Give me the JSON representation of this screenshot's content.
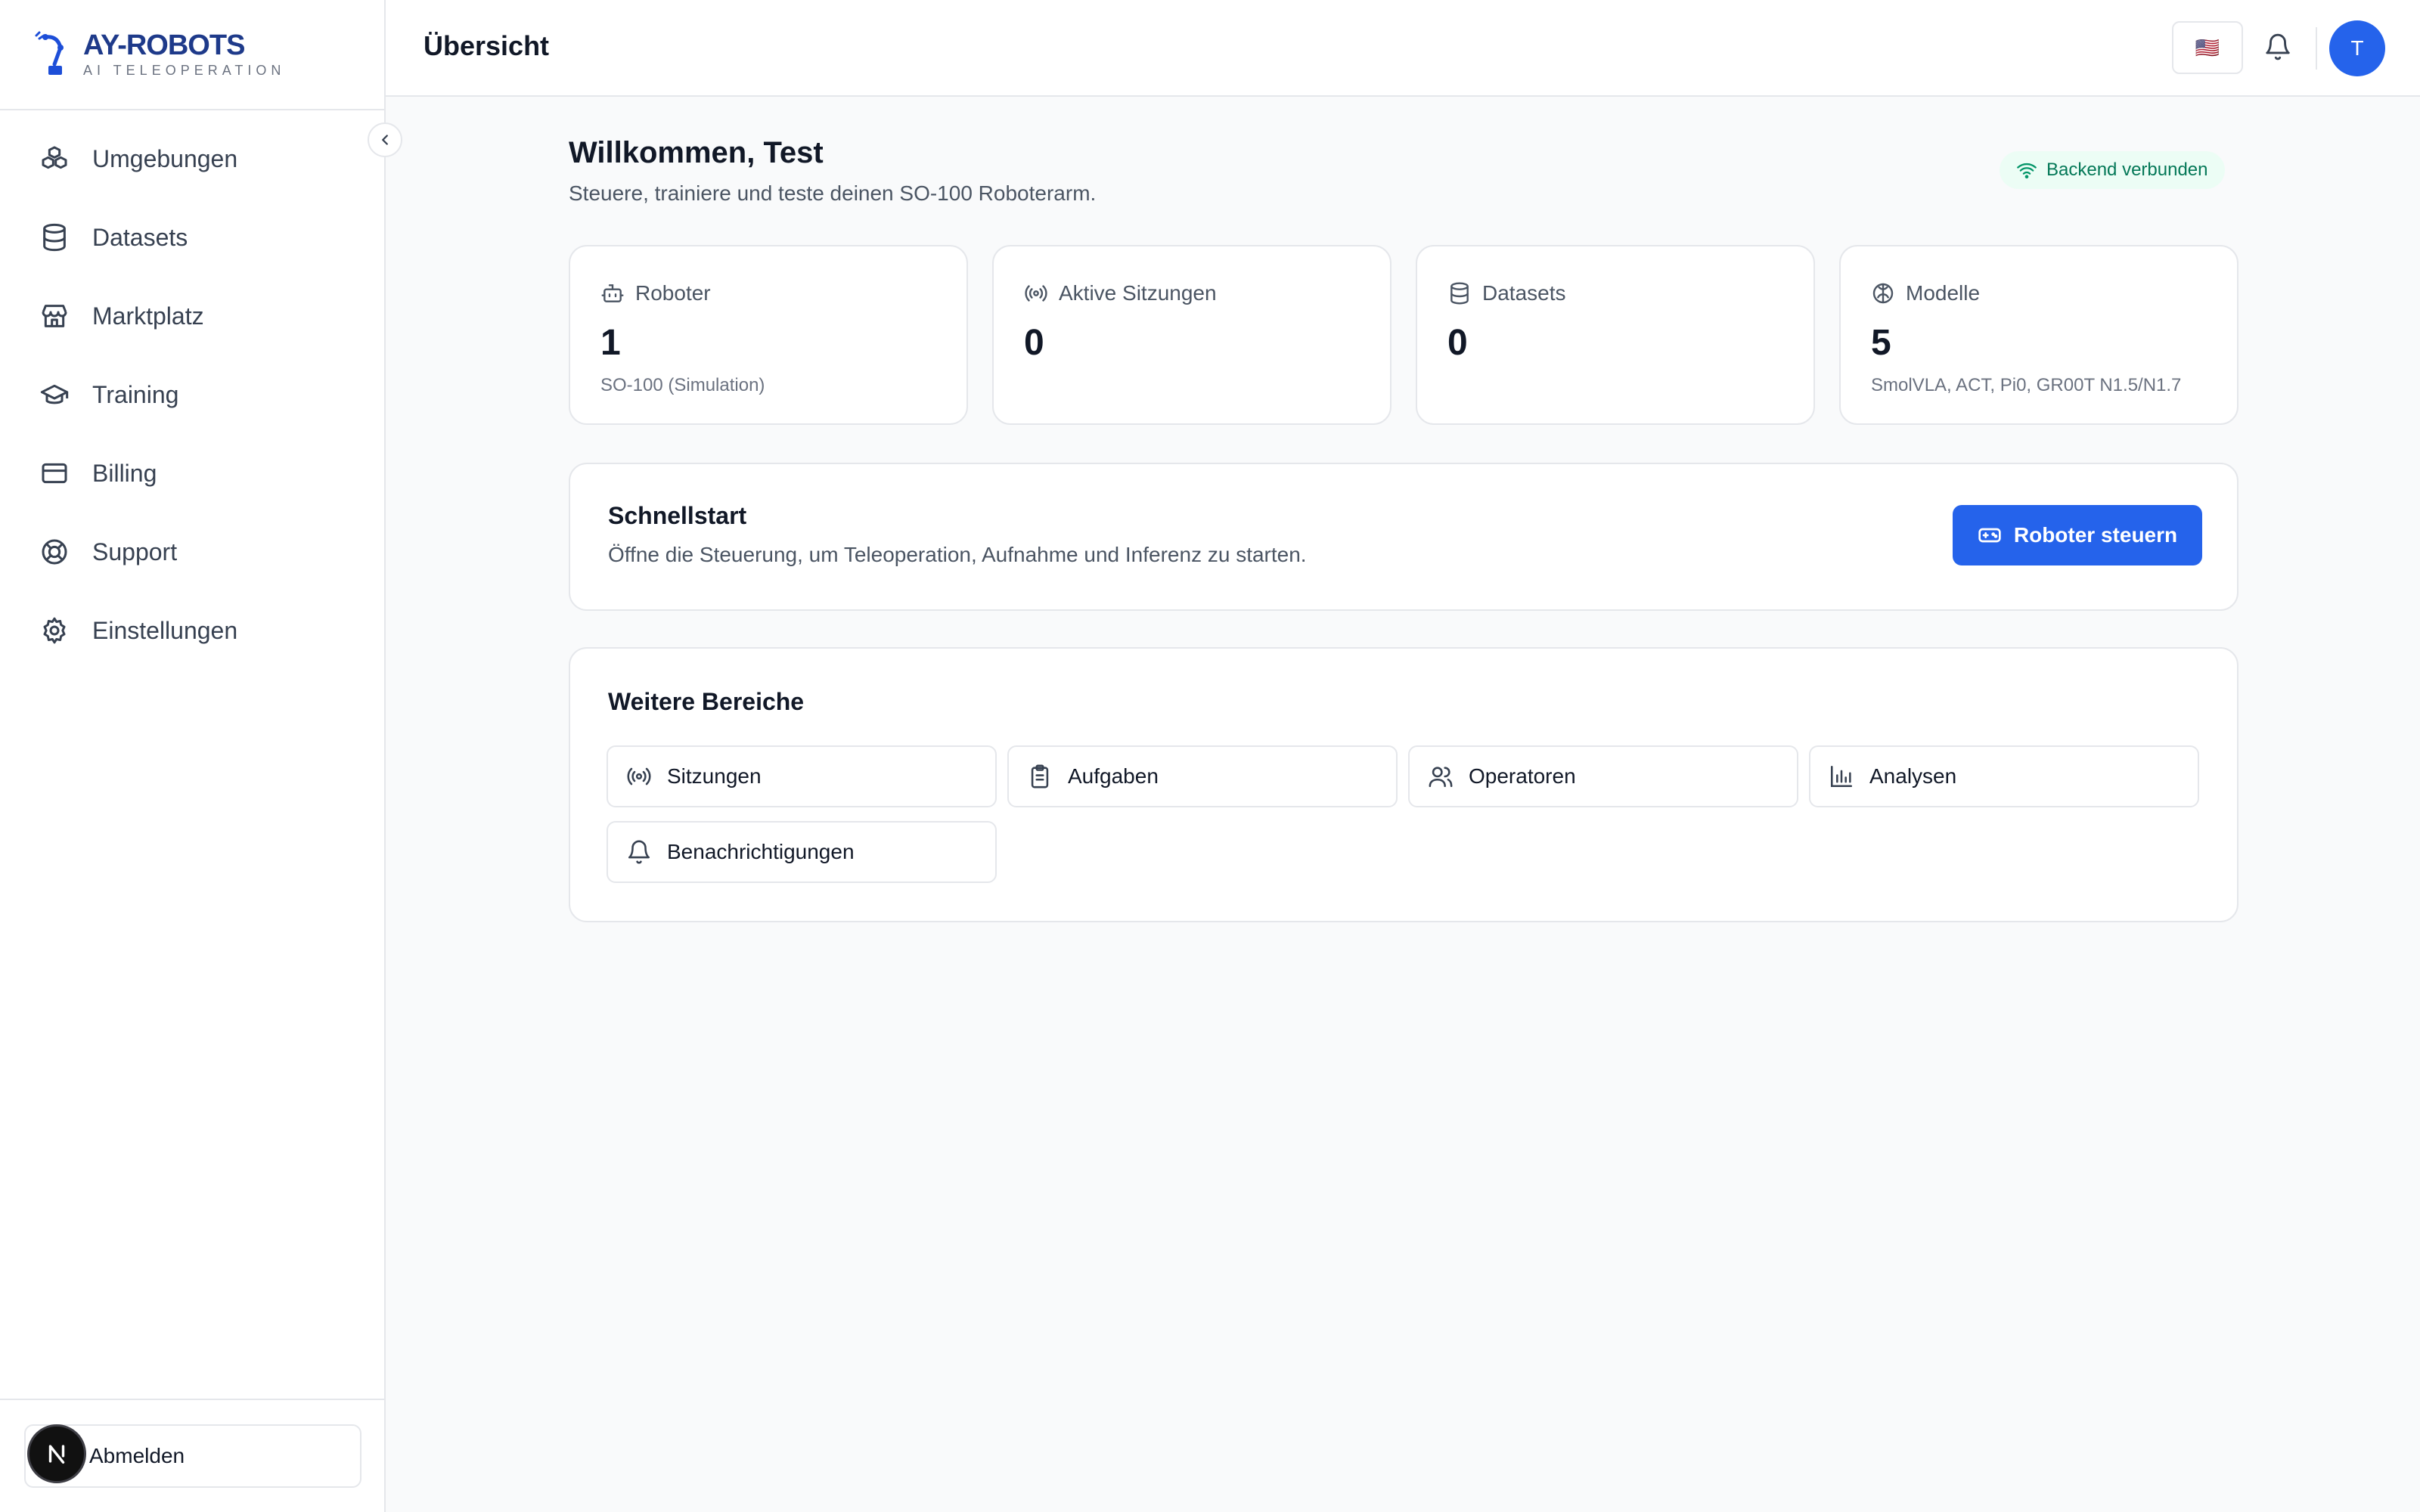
{
  "brand": {
    "name": "AY-ROBOTS",
    "tagline": "AI TELEOPERATION"
  },
  "sidebar": {
    "items": [
      {
        "label": "Umgebungen",
        "icon": "boxes-icon"
      },
      {
        "label": "Datasets",
        "icon": "database-icon"
      },
      {
        "label": "Marktplatz",
        "icon": "store-icon"
      },
      {
        "label": "Training",
        "icon": "graduation-cap-icon"
      },
      {
        "label": "Billing",
        "icon": "credit-card-icon"
      },
      {
        "label": "Support",
        "icon": "life-buoy-icon"
      },
      {
        "label": "Einstellungen",
        "icon": "gear-icon"
      }
    ],
    "logout_label": "Abmelden",
    "dev_badge": "N"
  },
  "header": {
    "title": "Übersicht",
    "language_flag": "🇺🇸",
    "avatar_initial": "T"
  },
  "welcome": {
    "title": "Willkommen, Test",
    "subtitle": "Steuere, trainiere und teste deinen SO-100 Roboterarm.",
    "status": "Backend verbunden"
  },
  "stats": [
    {
      "label": "Roboter",
      "value": "1",
      "sub": "SO-100 (Simulation)",
      "icon": "bot-icon"
    },
    {
      "label": "Aktive Sitzungen",
      "value": "0",
      "sub": "",
      "icon": "radio-icon"
    },
    {
      "label": "Datasets",
      "value": "0",
      "sub": "",
      "icon": "database-icon"
    },
    {
      "label": "Modelle",
      "value": "5",
      "sub": "SmolVLA, ACT, Pi0, GR00T N1.5/N1.7",
      "icon": "brain-icon"
    }
  ],
  "quickstart": {
    "title": "Schnellstart",
    "description": "Öffne die Steuerung, um Teleoperation, Aufnahme und Inferenz zu starten.",
    "button": "Roboter steuern"
  },
  "more": {
    "title": "Weitere Bereiche",
    "items": [
      {
        "label": "Sitzungen",
        "icon": "radio-icon"
      },
      {
        "label": "Aufgaben",
        "icon": "clipboard-icon"
      },
      {
        "label": "Operatoren",
        "icon": "users-icon"
      },
      {
        "label": "Analysen",
        "icon": "bar-chart-icon"
      },
      {
        "label": "Benachrichtigungen",
        "icon": "bell-icon"
      }
    ]
  },
  "colors": {
    "primary": "#2563eb",
    "brand": "#1e3a8a",
    "success_text": "#047857",
    "success_bg": "#ecfdf5",
    "border": "#e5e7eb",
    "background": "#f9fafb"
  }
}
